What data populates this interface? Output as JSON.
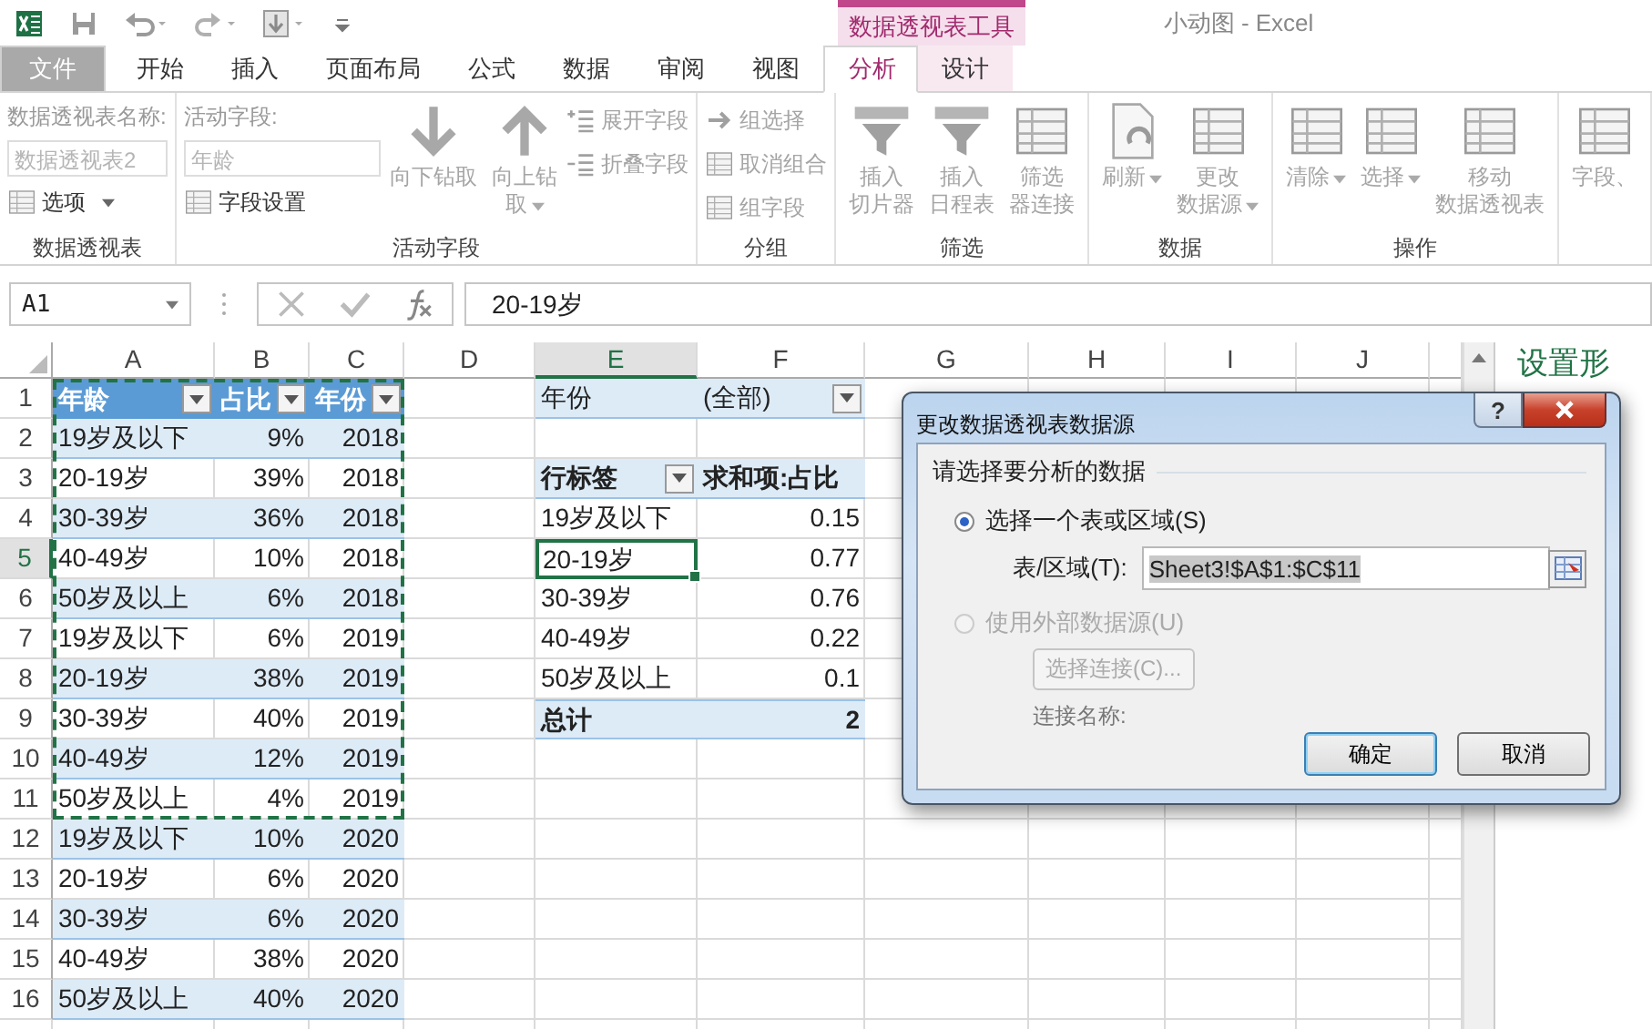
{
  "title_bar": {
    "title": "小动图 - Excel",
    "context_group": "数据透视表工具"
  },
  "tabs": [
    {
      "label": "文件",
      "kind": "file",
      "selected": false
    },
    {
      "label": "开始",
      "kind": "normal",
      "selected": false
    },
    {
      "label": "插入",
      "kind": "normal",
      "selected": false
    },
    {
      "label": "页面布局",
      "kind": "normal",
      "selected": false
    },
    {
      "label": "公式",
      "kind": "normal",
      "selected": false
    },
    {
      "label": "数据",
      "kind": "normal",
      "selected": false
    },
    {
      "label": "审阅",
      "kind": "normal",
      "selected": false
    },
    {
      "label": "视图",
      "kind": "normal",
      "selected": false
    },
    {
      "label": "分析",
      "kind": "context",
      "selected": true
    },
    {
      "label": "设计",
      "kind": "context",
      "selected": false
    }
  ],
  "ribbon": {
    "groups": [
      {
        "label": "数据透视表",
        "controls": [
          {
            "kind": "stack",
            "items": [
              {
                "kind": "caption",
                "text": "数据透视表名称:"
              },
              {
                "kind": "field",
                "value": "数据透视表2",
                "disabled": true
              },
              {
                "kind": "small",
                "label": "选项",
                "dropdown": true,
                "disabled": false
              }
            ]
          }
        ]
      },
      {
        "label": "活动字段",
        "controls": [
          {
            "kind": "stack",
            "items": [
              {
                "kind": "caption",
                "text": "活动字段:"
              },
              {
                "kind": "field",
                "value": "年龄",
                "disabled": true
              },
              {
                "kind": "small",
                "label": "字段设置",
                "dropdown": false,
                "disabled": false
              }
            ]
          },
          {
            "kind": "large",
            "lines": [
              "向下钻取"
            ],
            "dropdown": false,
            "disabled": true
          },
          {
            "kind": "large",
            "lines": [
              "向上钻",
              "取"
            ],
            "dropdown": true,
            "disabled": true
          },
          {
            "kind": "stack",
            "items": [
              {
                "kind": "small",
                "label": "展开字段",
                "dropdown": false,
                "disabled": true
              },
              {
                "kind": "small",
                "label": "折叠字段",
                "dropdown": false,
                "disabled": true
              }
            ]
          }
        ]
      },
      {
        "label": "分组",
        "controls": [
          {
            "kind": "stack",
            "items": [
              {
                "kind": "small",
                "label": "组选择",
                "dropdown": false,
                "disabled": true
              },
              {
                "kind": "small",
                "label": "取消组合",
                "dropdown": false,
                "disabled": true
              },
              {
                "kind": "small",
                "label": "组字段",
                "dropdown": false,
                "disabled": true
              }
            ]
          }
        ]
      },
      {
        "label": "筛选",
        "controls": [
          {
            "kind": "large",
            "lines": [
              "插入",
              "切片器"
            ],
            "dropdown": false,
            "disabled": true
          },
          {
            "kind": "large",
            "lines": [
              "插入",
              "日程表"
            ],
            "dropdown": false,
            "disabled": true
          },
          {
            "kind": "large",
            "lines": [
              "筛选",
              "器连接"
            ],
            "dropdown": false,
            "disabled": true
          }
        ]
      },
      {
        "label": "数据",
        "controls": [
          {
            "kind": "large",
            "lines": [
              "刷新"
            ],
            "dropdown": true,
            "disabled": true
          },
          {
            "kind": "large",
            "lines": [
              "更改",
              "数据源"
            ],
            "dropdown": true,
            "disabled": true
          }
        ]
      },
      {
        "label": "操作",
        "controls": [
          {
            "kind": "large",
            "lines": [
              "清除"
            ],
            "dropdown": true,
            "disabled": true
          },
          {
            "kind": "large",
            "lines": [
              "选择"
            ],
            "dropdown": true,
            "disabled": true
          },
          {
            "kind": "large",
            "lines": [
              "移动",
              "数据透视表"
            ],
            "dropdown": false,
            "disabled": true
          }
        ]
      },
      {
        "controls": [
          {
            "kind": "large",
            "lines": [
              "字段、"
            ],
            "dropdown": false,
            "disabled": true
          }
        ]
      }
    ]
  },
  "formula_bar": {
    "name_box": "A1",
    "formula": "20-19岁"
  },
  "sheet": {
    "columns": [
      {
        "label": "A",
        "selected": false
      },
      {
        "label": "B",
        "selected": false
      },
      {
        "label": "C",
        "selected": false
      },
      {
        "label": "D",
        "selected": false
      },
      {
        "label": "E",
        "selected": true
      },
      {
        "label": "F",
        "selected": false
      },
      {
        "label": "G",
        "selected": false
      },
      {
        "label": "H",
        "selected": false
      },
      {
        "label": "I",
        "selected": false
      },
      {
        "label": "J",
        "selected": false
      }
    ],
    "rows": [
      {
        "label": "1",
        "selected": false
      },
      {
        "label": "2",
        "selected": false
      },
      {
        "label": "3",
        "selected": false
      },
      {
        "label": "4",
        "selected": false
      },
      {
        "label": "5",
        "selected": true
      },
      {
        "label": "6",
        "selected": false
      },
      {
        "label": "7",
        "selected": false
      },
      {
        "label": "8",
        "selected": false
      },
      {
        "label": "9",
        "selected": false
      },
      {
        "label": "10",
        "selected": false
      },
      {
        "label": "11",
        "selected": false
      },
      {
        "label": "12",
        "selected": false
      },
      {
        "label": "13",
        "selected": false
      },
      {
        "label": "14",
        "selected": false
      },
      {
        "label": "15",
        "selected": false
      },
      {
        "label": "16",
        "selected": false
      }
    ],
    "source_table": {
      "headers": [
        "年龄",
        "占比",
        "年份"
      ],
      "rows": [
        [
          "19岁及以下",
          "9%",
          "2018"
        ],
        [
          "20-19岁",
          "39%",
          "2018"
        ],
        [
          "30-39岁",
          "36%",
          "2018"
        ],
        [
          "40-49岁",
          "10%",
          "2018"
        ],
        [
          "50岁及以上",
          "6%",
          "2018"
        ],
        [
          "19岁及以下",
          "6%",
          "2019"
        ],
        [
          "20-19岁",
          "38%",
          "2019"
        ],
        [
          "30-39岁",
          "40%",
          "2019"
        ],
        [
          "40-49岁",
          "12%",
          "2019"
        ],
        [
          "50岁及以上",
          "4%",
          "2019"
        ],
        [
          "19岁及以下",
          "10%",
          "2020"
        ],
        [
          "20-19岁",
          "6%",
          "2020"
        ],
        [
          "30-39岁",
          "6%",
          "2020"
        ],
        [
          "40-49岁",
          "38%",
          "2020"
        ],
        [
          "50岁及以上",
          "40%",
          "2020"
        ]
      ]
    },
    "pivot": {
      "filter_label": "年份",
      "filter_value": "(全部)",
      "row_header": "行标签",
      "value_header": "求和项:占比",
      "rows": [
        {
          "label": "19岁及以下",
          "value": "0.15",
          "selected": false
        },
        {
          "label": "20-19岁",
          "value": "0.77",
          "selected": true
        },
        {
          "label": "30-39岁",
          "value": "0.76",
          "selected": false
        },
        {
          "label": "40-49岁",
          "value": "0.22",
          "selected": false
        },
        {
          "label": "50岁及以上",
          "value": "0.1",
          "selected": false
        }
      ],
      "total_label": "总计",
      "total_value": "2"
    }
  },
  "side_panel": {
    "title": "设置形"
  },
  "dialog": {
    "title": "更改数据透视表数据源",
    "help_label": "?",
    "section": "请选择要分析的数据",
    "options": [
      {
        "label": "选择一个表或区域(S)",
        "selected": true,
        "disabled": false
      },
      {
        "label": "使用外部数据源(U)",
        "selected": false,
        "disabled": true
      }
    ],
    "range_label": "表/区域(T):",
    "range_value": "Sheet3!$A$1:$C$11",
    "range_highlighted": true,
    "connect_button": {
      "label": "选择连接(C)...",
      "disabled": true
    },
    "connection_label": "连接名称:",
    "buttons": [
      {
        "label": "确定",
        "kind": "default"
      },
      {
        "label": "取消",
        "kind": "normal"
      }
    ]
  }
}
